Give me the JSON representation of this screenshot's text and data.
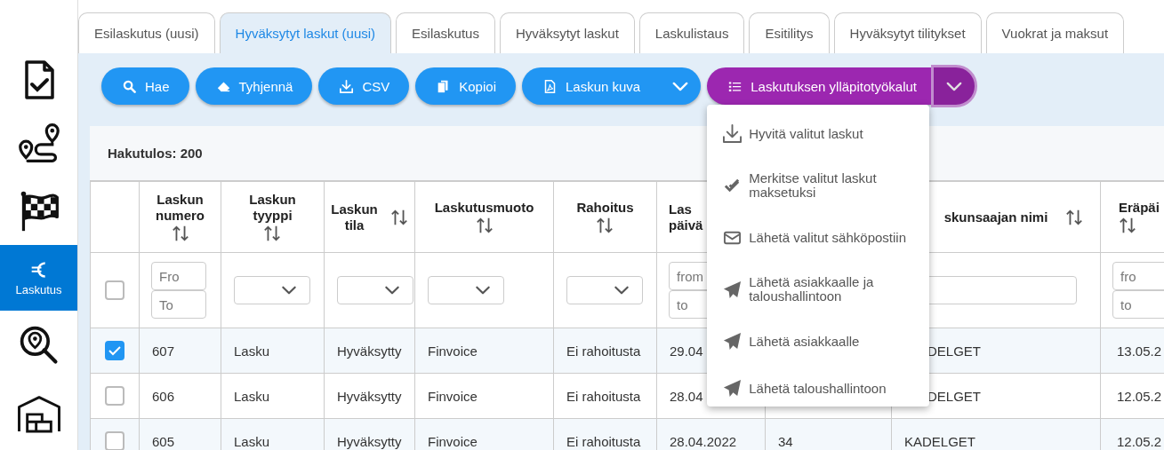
{
  "sidebar": {
    "items": [
      {
        "selected": false
      },
      {
        "selected": false
      },
      {
        "selected": false
      },
      {
        "label": "Laskutus",
        "selected": true
      },
      {
        "selected": false
      },
      {
        "selected": false
      }
    ]
  },
  "tabs": [
    {
      "label": "Esilaskutus (uusi)",
      "selected": false
    },
    {
      "label": "Hyväksytyt laskut (uusi)",
      "selected": true
    },
    {
      "label": "Esilaskutus",
      "selected": false
    },
    {
      "label": "Hyväksytyt laskut",
      "selected": false
    },
    {
      "label": "Laskulistaus",
      "selected": false
    },
    {
      "label": "Esitilitys",
      "selected": false
    },
    {
      "label": "Hyväksytyt tilitykset",
      "selected": false
    },
    {
      "label": "Vuokrat ja maksut",
      "selected": false
    }
  ],
  "toolbar": [
    {
      "label": "Hae",
      "color": "#2196f3",
      "dropdown": false
    },
    {
      "label": "Tyhjennä",
      "color": "#2196f3",
      "dropdown": false
    },
    {
      "label": "CSV",
      "color": "#2196f3",
      "dropdown": false
    },
    {
      "label": "Kopioi",
      "color": "#2196f3",
      "dropdown": false
    },
    {
      "label": "Laskun kuva",
      "color": "#2196f3",
      "dropdown": true,
      "expanded": false
    },
    {
      "label": "Laskutuksen ylläpitotyökalut",
      "color": "#9c27b0",
      "dropdown": true,
      "expanded": true,
      "menu": [
        {
          "label": "Hyvitä valitut laskut"
        },
        {
          "label": "Merkitse valitut laskut maksetuksi"
        },
        {
          "label": "Lähetä valitut sähköpostiin"
        },
        {
          "label": "Lähetä asiakkaalle ja taloushallintoon"
        },
        {
          "label": "Lähetä asiakkaalle"
        },
        {
          "label": "Lähetä taloushallintoon"
        }
      ]
    }
  ],
  "result_count": "Hakutulos: 200",
  "table": {
    "select_all": {
      "checked": false
    },
    "columns": [
      {
        "header": "Laskun numero",
        "sortable": true,
        "filter": {
          "kind": "range",
          "fields": [
            {
              "placeholder": "Fro"
            },
            {
              "placeholder": "To"
            }
          ]
        }
      },
      {
        "header": "Laskun tyyppi",
        "sortable": true,
        "filter": {
          "kind": "select"
        }
      },
      {
        "header": "Laskun tila",
        "sortable": true,
        "filter": {
          "kind": "select"
        }
      },
      {
        "header": "Laskutusmuoto",
        "sortable": true,
        "filter": {
          "kind": "select"
        }
      },
      {
        "header": "Rahoitus",
        "sortable": true,
        "filter": {
          "kind": "select"
        }
      },
      {
        "header": "Las päivä",
        "sortable": false,
        "filter": {
          "kind": "range",
          "fields": [
            {
              "placeholder": "from"
            },
            {
              "placeholder": "to"
            }
          ]
        }
      },
      {},
      {
        "header": "skunsaajan nimi",
        "sortable": true,
        "filter": {
          "kind": "text"
        }
      },
      {
        "header": "Eräpäi",
        "sortable": true,
        "filter": {
          "kind": "range",
          "fields": [
            {
              "placeholder": "fro"
            },
            {
              "placeholder": "to"
            }
          ]
        }
      }
    ],
    "rows": [
      {
        "selected": true,
        "cells": [
          "607",
          "Lasku",
          "Hyväksytty",
          "Finvoice",
          "Ei rahoitusta",
          "29.04",
          null,
          "DELGET",
          "13.05.2"
        ]
      },
      {
        "selected": false,
        "cells": [
          "606",
          "Lasku",
          "Hyväksytty",
          "Finvoice",
          "Ei rahoitusta",
          "28.04",
          null,
          "DELGET",
          "12.05.2"
        ]
      },
      {
        "selected": false,
        "cells": [
          "605",
          "Lasku",
          "Hyväksytty",
          "Finvoice",
          "Ei rahoitusta",
          "28.04.2022",
          "34",
          "KADELGET",
          "12.05.2"
        ]
      }
    ]
  }
}
